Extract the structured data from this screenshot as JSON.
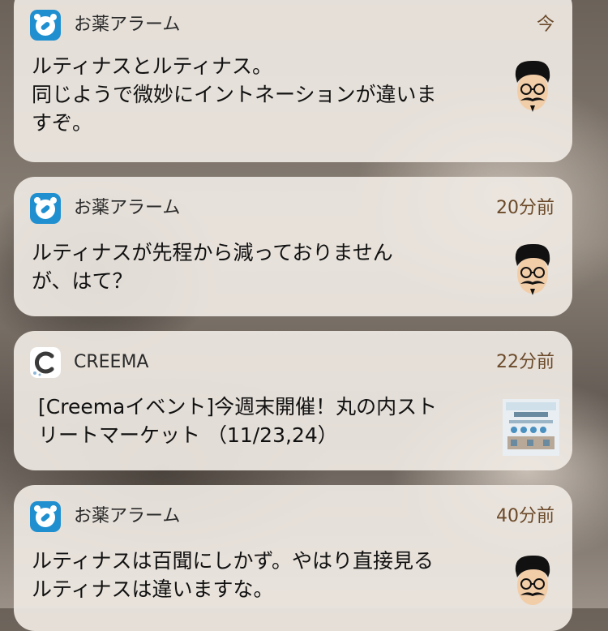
{
  "notifications": [
    {
      "app": "お薬アラーム",
      "time": "今",
      "message": "ルティナスとルティナス。\n同じようで微妙にイントネーションが違いま\nすぞ。",
      "icon": "pill-alarm-icon",
      "thumbnail": "mustache-man-face"
    },
    {
      "app": "お薬アラーム",
      "time": "20分前",
      "message": "ルティナスが先程から減っておりません\nが、はて？",
      "icon": "pill-alarm-icon",
      "thumbnail": "mustache-man-face"
    },
    {
      "app": "CREEMA",
      "time": "22分前",
      "message": "[Creemaイベント]今週末開催！丸の内スト\nリートマーケット （11/23,24）",
      "icon": "creema-c-icon",
      "thumbnail": "event-flyer"
    },
    {
      "app": "お薬アラーム",
      "time": "40分前",
      "message": "ルティナスは百聞にしかず。やはり直接見る\nルティナスは違いますな。",
      "icon": "pill-alarm-icon",
      "thumbnail": "mustache-man-face"
    }
  ],
  "colors": {
    "card_bg": "#eee8e2",
    "time_text": "#6b4a2a",
    "pill_icon_bg": "#1f8fd0"
  }
}
